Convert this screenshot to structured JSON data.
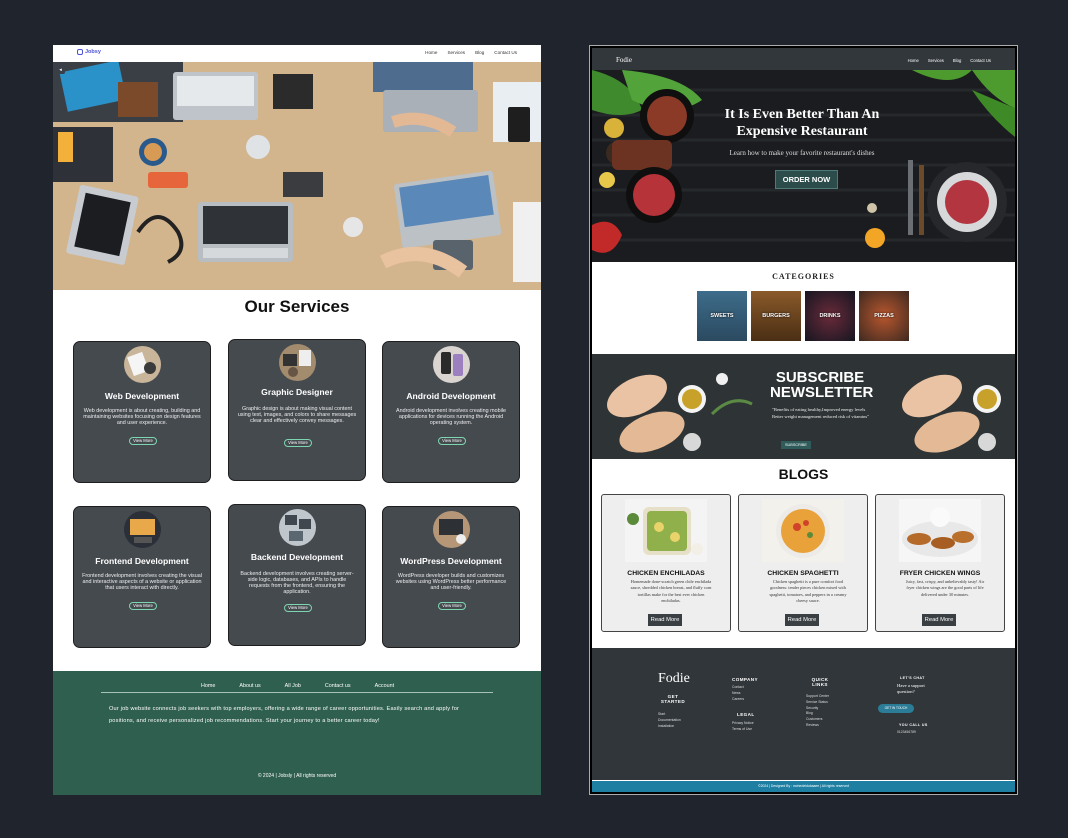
{
  "jobsy": {
    "brand": "Jobsy",
    "nav": [
      "Home",
      "Services",
      "Blog",
      "Contact Us"
    ],
    "back_glyph": "◂",
    "section_title": "Our Services",
    "cards": [
      {
        "title": "Web Development",
        "desc": "Web development is about creating, building and maintaining websites focusing on design features and user experience.",
        "button": "View More"
      },
      {
        "title": "Graphic Designer",
        "desc": "Graphic design is about making visual content using text, images, and colors to share messages clear and effectively convey messages.",
        "button": "View More"
      },
      {
        "title": "Android Development",
        "desc": "Android development involves creating mobile applications for devices running the Android operating system.",
        "button": "View More"
      },
      {
        "title": "Frontend Development",
        "desc": "Frontend development involves creating the visual and interactive aspects of a website or application that users interact with directly.",
        "button": "View More"
      },
      {
        "title": "Backend Development",
        "desc": "Backend development involves creating server-side logic, databases, and APIs to handle requests from the frontend, ensuring the application.",
        "button": "View More"
      },
      {
        "title": "WordPress Development",
        "desc": "WordPress developer builds and customizes websites using WordPress better performance and user-friendly.",
        "button": "View More"
      }
    ],
    "footer": {
      "links": [
        "Home",
        "About us",
        "All Job",
        "Contact us",
        "Account"
      ],
      "text": "Our job website connects job seekers with top employers, offering a wide range of career opportunities. Easily search and apply for positions, and receive personalized job recommendations. Start your journey to a better career today!",
      "copyright": "© 2024 | Jobsly | All rights reserved"
    },
    "colors": {
      "footer": "#2f5f4e",
      "card": "#454a4f",
      "brand": "#4a52d6"
    }
  },
  "fodie": {
    "brand": "Fodie",
    "nav": [
      "Home",
      "Services",
      "Blog",
      "Contact Us"
    ],
    "hero": {
      "title": "It Is Even Better Than An Expensive Restaurant",
      "subtitle": "Learn how to make your favorite restaurant's dishes",
      "button": "ORDER NOW"
    },
    "categories_title": "CATEGORIES",
    "categories": [
      "SWEETS",
      "BURGERS",
      "DRINKS",
      "PIZZAS"
    ],
    "newsletter": {
      "title": "SUBSCRIBE NEWSLETTER",
      "text": "\"Benefits of eating healthy,Improved energy levels Better weight management reduced risk of vitamins\"",
      "button": "SUBSCRIBE"
    },
    "blogs_title": "BLOGS",
    "blogs": [
      {
        "title": "CHICKEN ENCHILADAS",
        "desc": "Homemade done-scratch green chile enchilada sauce, shredded chicken breast, and fluffy corn tortillas make for the best ever chicken enchiladas.",
        "button": "Read More"
      },
      {
        "title": "CHICKEN SPAGHETTI",
        "desc": "Chicken spaghetti is a pure comfort food goodness: tender pieces chicken mixed with spaghetti, tomatoes, and peppers in a creamy cheesy sauce.",
        "button": "Read More"
      },
      {
        "title": "FRYER CHICKEN WINGS",
        "desc": "Juicy, fast, crispy, and unbelievably tasty! Air fryer chicken wings are the good parts of life delivered under 30 minutes.",
        "button": "Read More"
      }
    ],
    "footer": {
      "get_started": {
        "heading": "GET STARTED",
        "items": [
          "Start",
          "Documentation",
          "Installation"
        ]
      },
      "company": {
        "heading": "COMPANY",
        "items": [
          "Contact",
          "News",
          "Careers"
        ]
      },
      "legal": {
        "heading": "LEGAL",
        "items": [
          "Privacy Notice",
          "Terms of Use"
        ]
      },
      "quick_links": {
        "heading": "QUICK LINKS",
        "items": [
          "Support Center",
          "Service Status",
          "Security",
          "Blog",
          "Customers",
          "Reviews"
        ]
      },
      "chat": {
        "heading": "LET'S CHAT",
        "text": "Have a support question?",
        "button": "GET IN TOUCH"
      },
      "call": {
        "heading": "YOU CALL US",
        "number": "0123456789"
      },
      "bottom": "©2024 | Designed By : mohedeldubaaee | All rights reserved"
    },
    "colors": {
      "nav": "#32373c",
      "order_button": "#2c4c4c",
      "bottom_bar": "#1f7fa3"
    }
  }
}
